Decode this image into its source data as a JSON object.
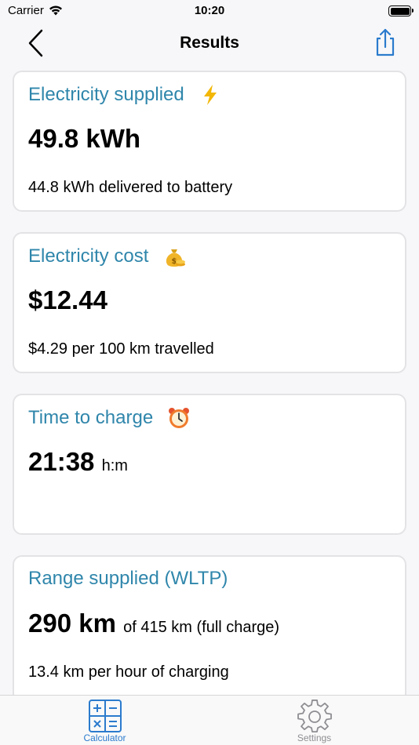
{
  "status_bar": {
    "carrier": "Carrier",
    "time": "10:20"
  },
  "nav": {
    "title": "Results"
  },
  "cards": [
    {
      "title": "Electricity supplied",
      "icon": "lightning-icon",
      "value": "49.8 kWh",
      "unit": "",
      "detail": "44.8 kWh delivered to battery"
    },
    {
      "title": "Electricity cost",
      "icon": "money-bag-icon",
      "value": "$12.44",
      "unit": "",
      "detail": "$4.29 per 100 km travelled"
    },
    {
      "title": "Time to charge",
      "icon": "alarm-clock-icon",
      "value": "21:38",
      "unit": "h:m",
      "detail": ""
    },
    {
      "title": "Range supplied (WLTP)",
      "icon": "",
      "value": "290 km",
      "unit": "of 415 km (full charge)",
      "detail": "13.4 km per hour of charging"
    }
  ],
  "tabs": [
    {
      "label": "Calculator",
      "icon": "calculator-icon",
      "active": true
    },
    {
      "label": "Settings",
      "icon": "gear-icon",
      "active": false
    }
  ],
  "colors": {
    "accent": "#2f86ab",
    "tab_active": "#2b7bcd",
    "tab_inactive": "#8e8e93"
  }
}
